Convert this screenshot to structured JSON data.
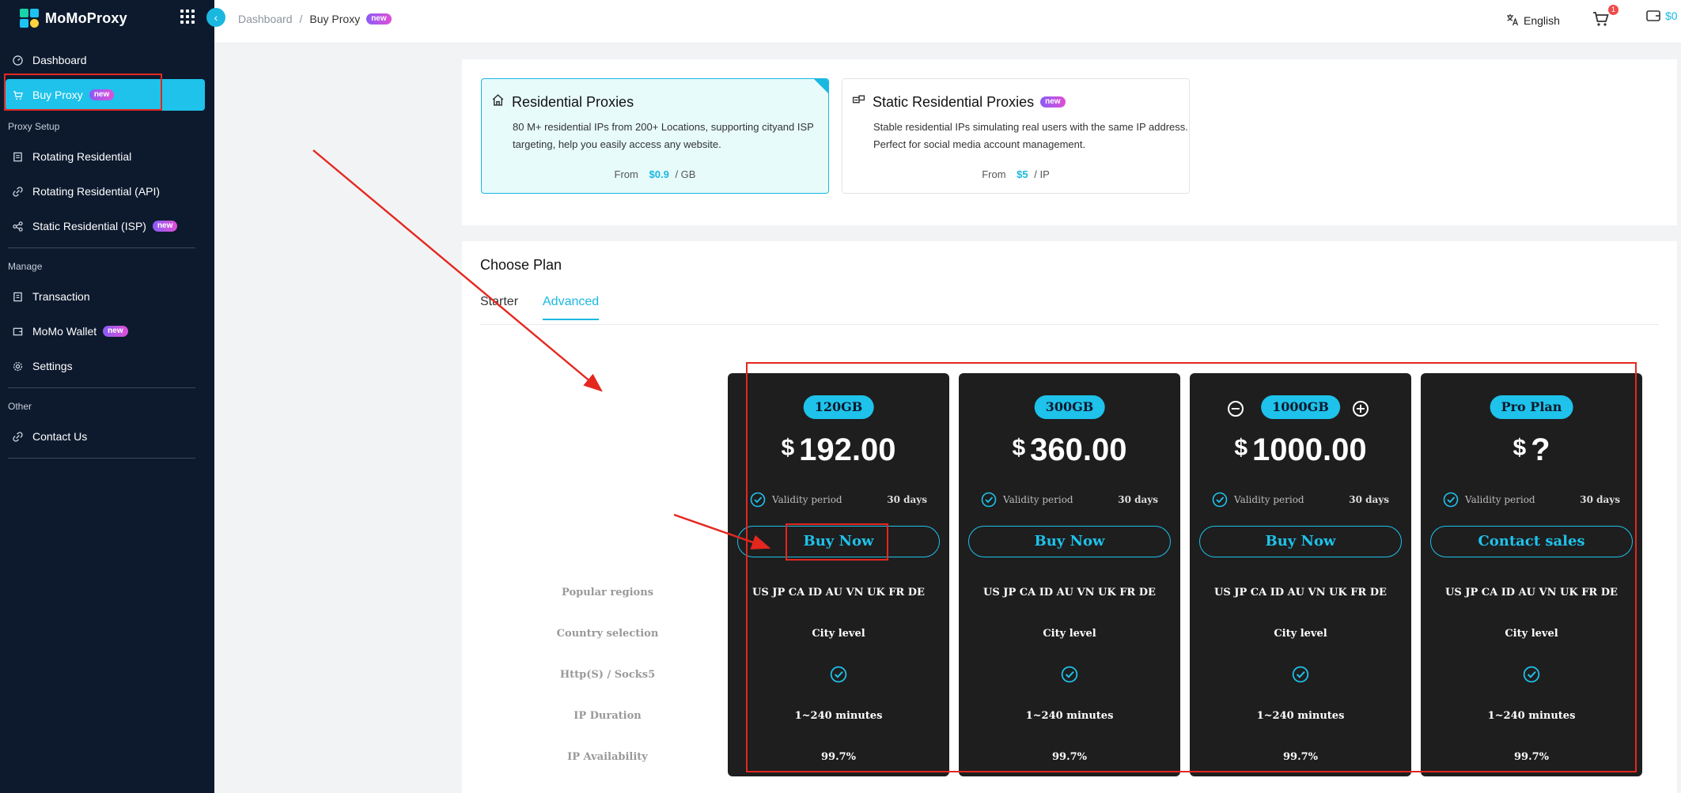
{
  "brand": {
    "name": "MoMoProxy"
  },
  "sidebar": {
    "items": [
      {
        "label": "Dashboard",
        "icon": "dashboard-icon"
      },
      {
        "label": "Buy Proxy",
        "icon": "cart-icon",
        "badge": "new",
        "active": true
      }
    ],
    "sections": [
      {
        "label": "Proxy Setup",
        "items": [
          {
            "label": "Rotating Residential",
            "icon": "document-icon"
          },
          {
            "label": "Rotating Residential (API)",
            "icon": "link-icon"
          },
          {
            "label": "Static Residential (ISP)",
            "icon": "share-icon",
            "badge": "new"
          }
        ]
      },
      {
        "label": "Manage",
        "items": [
          {
            "label": "Transaction",
            "icon": "receipt-icon"
          },
          {
            "label": "MoMo Wallet",
            "icon": "wallet-icon",
            "badge": "new"
          },
          {
            "label": "Settings",
            "icon": "gear-icon"
          }
        ]
      },
      {
        "label": "Other",
        "items": [
          {
            "label": "Contact Us",
            "icon": "link-icon"
          }
        ]
      }
    ]
  },
  "topbar": {
    "breadcrumb": {
      "root": "Dashboard",
      "separator": "/",
      "current": "Buy Proxy",
      "badge": "new"
    },
    "language": "English",
    "cart_count": "1",
    "wallet_text": "$0"
  },
  "products": [
    {
      "title": "Residential Proxies",
      "description": "80 M+ residential IPs from 200+ Locations, supporting cityand ISP targeting, help you easily access any website.",
      "price_prefix": "From",
      "price": "$0.9",
      "price_unit": "/ GB",
      "selected": true
    },
    {
      "title": "Static Residential Proxies",
      "badge": "new",
      "description": "Stable residential IPs simulating real users with the same IP address. Perfect for social media account management.",
      "price_prefix": "From",
      "price": "$5",
      "price_unit": "/ IP",
      "selected": false
    }
  ],
  "plan": {
    "title": "Choose Plan",
    "tabs": [
      {
        "label": "Starter",
        "active": false
      },
      {
        "label": "Advanced",
        "active": true
      }
    ],
    "row_labels": [
      "Popular regions",
      "Country selection",
      "Http(S) / Socks5",
      "IP Duration",
      "IP Availability"
    ],
    "cards": [
      {
        "size": "120GB",
        "currency": "$",
        "price": "192.00",
        "validity_label": "Validity period",
        "validity": "30 days",
        "button": "Buy Now",
        "regions": "US JP CA ID AU VN UK FR DE",
        "country": "City level",
        "duration": "1~240 minutes",
        "availability": "99.7%",
        "stepper": false
      },
      {
        "size": "300GB",
        "currency": "$",
        "price": "360.00",
        "validity_label": "Validity period",
        "validity": "30 days",
        "button": "Buy Now",
        "regions": "US JP CA ID AU VN UK FR DE",
        "country": "City level",
        "duration": "1~240 minutes",
        "availability": "99.7%",
        "stepper": false
      },
      {
        "size": "1000GB",
        "currency": "$",
        "price": "1000.00",
        "validity_label": "Validity period",
        "validity": "30 days",
        "button": "Buy Now",
        "regions": "US JP CA ID AU VN UK FR DE",
        "country": "City level",
        "duration": "1~240 minutes",
        "availability": "99.7%",
        "stepper": true
      },
      {
        "size": "Pro Plan",
        "currency": "$",
        "price": "?",
        "validity_label": "Validity period",
        "validity": "30 days",
        "button": "Contact sales",
        "regions": "US JP CA ID AU VN UK FR DE",
        "country": "City level",
        "duration": "1~240 minutes",
        "availability": "99.7%",
        "stepper": false
      }
    ]
  },
  "colors": {
    "accent": "#1ec2ea",
    "sidebar_bg": "#0d1a2e",
    "card_bg": "#1e1e1f",
    "annotation": "#e4271f"
  }
}
